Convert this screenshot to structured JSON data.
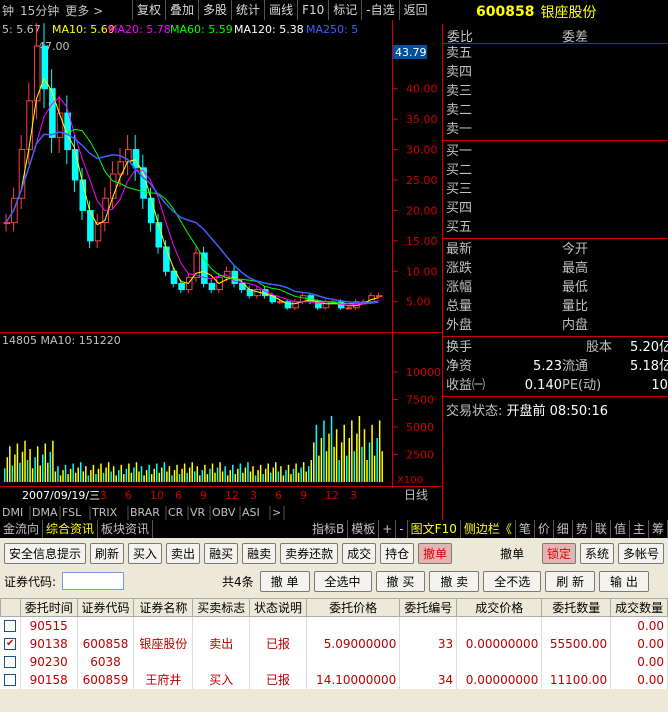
{
  "toolbar": {
    "period1": "钟",
    "period2": "15分钟",
    "more": "更多 >",
    "buttons": [
      "复权",
      "叠加",
      "多股",
      "统计",
      "画线",
      "F10",
      "标记",
      "-自选",
      "返回"
    ]
  },
  "stock": {
    "code": "600858",
    "name": "银座股份"
  },
  "ma_legend": {
    "prefix": "5: 5.67",
    "ma10": "MA10: 5.69",
    "ma20": "MA20: 5.78",
    "ma60": "MA60: 5.59",
    "ma120": "MA120: 5.38",
    "ma250": "MA250: 5"
  },
  "colors": {
    "ma10": "#ffff00",
    "ma20": "#ff00ff",
    "ma60": "#00ff00",
    "ma120": "#ffffff",
    "ma250": "#4060ff"
  },
  "chart_data": {
    "type": "line",
    "high_label": "47.00",
    "current_price": "43.79",
    "price_ticks": [
      "40.00",
      "35.00",
      "30.00",
      "25.00",
      "20.00",
      "15.00",
      "10.00",
      "5.00"
    ],
    "close": [
      18,
      22,
      30,
      38,
      47,
      40,
      32,
      36,
      30,
      25,
      20,
      15,
      18,
      22,
      26,
      28,
      30,
      27,
      22,
      18,
      14,
      10,
      8,
      7,
      9,
      13,
      8,
      7,
      9,
      10,
      8,
      7,
      6,
      7,
      6,
      5,
      5,
      4,
      5,
      6,
      5,
      4,
      5,
      5,
      4,
      4,
      5,
      5,
      6,
      6
    ],
    "volume_label": "14805   MA10: 151220",
    "volume_ticks": [
      "10000",
      "7500",
      "5000",
      "2500"
    ],
    "volume_unit": "X100",
    "dates": [
      "2007/09/19/三",
      "3",
      "6",
      "10",
      "6",
      "9",
      "12",
      "3",
      "6",
      "9",
      "12",
      "3"
    ],
    "right_label": "日线"
  },
  "quote": {
    "hdr": [
      "委比",
      "委差"
    ],
    "sell": [
      "卖五",
      "卖四",
      "卖三",
      "卖二",
      "卖一"
    ],
    "buy": [
      "买一",
      "买二",
      "买三",
      "买四",
      "买五"
    ],
    "stats": [
      [
        "最新",
        "",
        "今开",
        ""
      ],
      [
        "涨跌",
        "",
        "最高",
        ""
      ],
      [
        "涨幅",
        "",
        "最低",
        ""
      ],
      [
        "总量",
        "",
        "量比",
        ""
      ],
      [
        "外盘",
        "",
        "内盘",
        ""
      ]
    ],
    "stats2": [
      [
        "换手",
        "",
        "股本",
        "5.20亿"
      ],
      [
        "净资",
        "5.23",
        "流通",
        "5.18亿"
      ],
      [
        "收益㈠",
        "0.140",
        "PE(动)",
        "10."
      ]
    ],
    "status_label": "交易状态:",
    "status_value": "开盘前 08:50:16"
  },
  "tabs": [
    "金流向",
    "综合资讯",
    "板块资讯",
    "指标B",
    "模板",
    "+",
    "-",
    "图文F10",
    "侧边栏《",
    "笔",
    "价",
    "细",
    "势",
    "联",
    "值",
    "主",
    "筹"
  ],
  "indicators": [
    "DMI",
    "DMA",
    "FSL",
    "TRIX",
    "BRAR",
    "CR",
    "VR",
    "OBV",
    "ASI",
    ">"
  ],
  "trade": {
    "buttons": [
      "安全信息提示",
      "刷新",
      "买入",
      "卖出",
      "融买",
      "融卖",
      "卖券还款",
      "成交",
      "持仓",
      "撤单"
    ],
    "title": "撤单",
    "right_buttons": [
      "锁定",
      "系统",
      "多帐号"
    ],
    "code_label": "证券代码:",
    "count": "共4条",
    "actions": [
      "撤 单",
      "全选中",
      "撤 买",
      "撤 卖",
      "全不选",
      "刷 新",
      "输 出"
    ],
    "columns": [
      "委托时间",
      "证券代码",
      "证券名称",
      "买卖标志",
      "状态说明",
      "委托价格",
      "委托编号",
      "成交价格",
      "委托数量",
      "成交数量"
    ],
    "rows": [
      [
        "90515",
        "",
        "",
        "",
        "",
        "",
        "",
        "",
        "",
        "0.00"
      ],
      [
        "90138",
        "600858",
        "银座股份",
        "卖出",
        "已报",
        "5.09000000",
        "33",
        "0.00000000",
        "55500.00",
        "0.00"
      ],
      [
        "90230",
        "6038",
        "",
        "",
        "",
        "",
        "",
        "",
        "",
        "0.00"
      ],
      [
        "90158",
        "600859",
        "王府井",
        "买入",
        "已报",
        "14.10000000",
        "34",
        "0.00000000",
        "11100.00",
        "0.00"
      ]
    ]
  }
}
